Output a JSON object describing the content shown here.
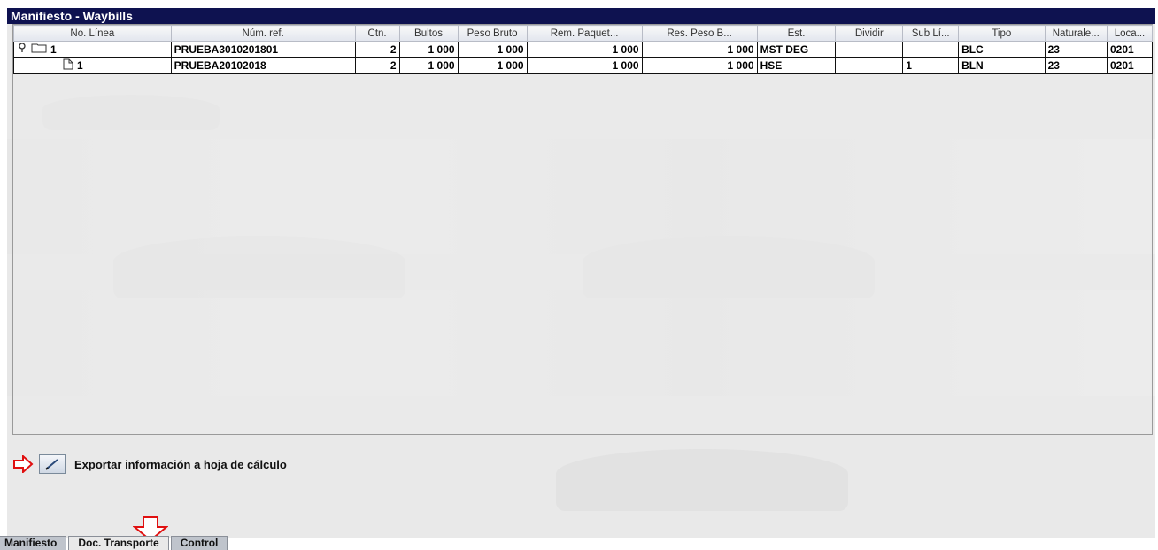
{
  "window": {
    "title": "Manifiesto - Waybills"
  },
  "grid": {
    "columns": [
      "No. Línea",
      "Núm. ref.",
      "Ctn.",
      "Bultos",
      "Peso Bruto",
      "Rem. Paquet...",
      "Res. Peso B...",
      "Est.",
      "Dividir",
      "Sub Lí...",
      "Tipo",
      "Naturale...",
      "Loca..."
    ],
    "rows": [
      {
        "line": "1",
        "ref": "PRUEBA3010201801",
        "ctn": "2",
        "bultos": "1 000",
        "peso_bruto": "1 000",
        "rem_paquet": "1 000",
        "res_peso": "1 000",
        "est": "MST DEG",
        "dividir": "",
        "sub_linea": "",
        "tipo": "BLC",
        "naturaleza": "23",
        "locacion": "0201"
      },
      {
        "line": "1",
        "ref": "PRUEBA20102018",
        "ctn": "2",
        "bultos": "1 000",
        "peso_bruto": "1 000",
        "rem_paquet": "1 000",
        "res_peso": "1 000",
        "est": "HSE",
        "dividir": "",
        "sub_linea": "1",
        "tipo": "BLN",
        "naturaleza": "23",
        "locacion": "0201"
      }
    ]
  },
  "export": {
    "label": "Exportar información a hoja de cálculo"
  },
  "tabs": [
    {
      "label": "Manifiesto"
    },
    {
      "label": "Doc. Transporte"
    },
    {
      "label": "Control"
    }
  ],
  "colors": {
    "titlebar": "#0e1250",
    "annotation_arrow": "#e01010"
  }
}
